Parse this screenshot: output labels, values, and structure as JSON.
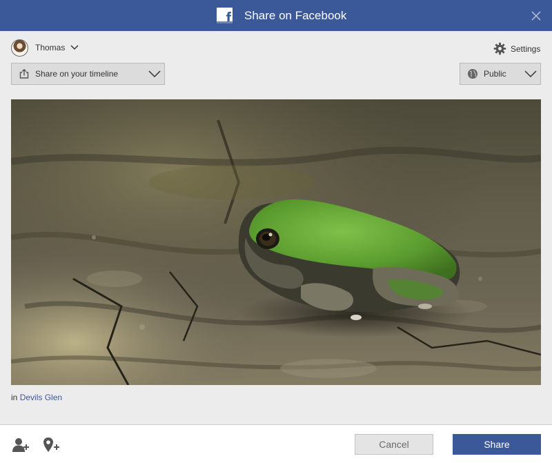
{
  "window": {
    "title": "Share on Facebook"
  },
  "user": {
    "name": "Thomas"
  },
  "settings": {
    "label": "Settings"
  },
  "share_target": {
    "label": "Share on your timeline"
  },
  "audience": {
    "label": "Public"
  },
  "photo": {
    "subject": "green frog on tree stump"
  },
  "location": {
    "prefix": "in",
    "place": "Devils Glen"
  },
  "buttons": {
    "cancel": "Cancel",
    "share": "Share"
  },
  "icons": {
    "logo": "facebook-logo-icon",
    "close": "close-icon",
    "settings": "gear-icon",
    "share_target": "share-icon",
    "audience": "globe-icon",
    "tag_friends": "add-person-icon",
    "add_location": "add-location-icon"
  },
  "colors": {
    "brand": "#3b5998",
    "link": "#3b5998",
    "background": "#ececec"
  }
}
